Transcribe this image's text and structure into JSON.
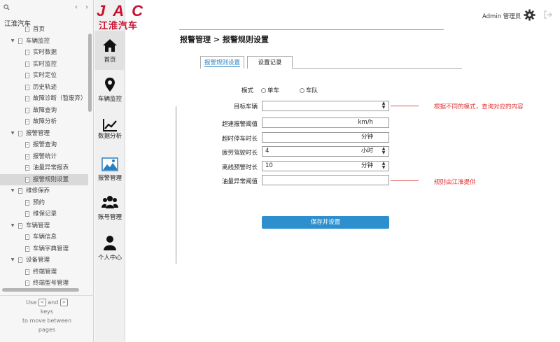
{
  "sidebar": {
    "doc_title": "江淮汽车",
    "prev": "‹",
    "next": "›",
    "tree": [
      {
        "label": "首页",
        "level": 1,
        "expand": ""
      },
      {
        "label": "车辆监控",
        "level": 0,
        "expand": "▼"
      },
      {
        "label": "实时数据",
        "level": 1,
        "expand": ""
      },
      {
        "label": "实时监控",
        "level": 1,
        "expand": ""
      },
      {
        "label": "实时定位",
        "level": 1,
        "expand": ""
      },
      {
        "label": "历史轨迹",
        "level": 1,
        "expand": ""
      },
      {
        "label": "故障诊断（暂废弃）",
        "level": 1,
        "expand": ""
      },
      {
        "label": "故障查询",
        "level": 1,
        "expand": ""
      },
      {
        "label": "故障分析",
        "level": 1,
        "expand": ""
      },
      {
        "label": "报警管理",
        "level": 0,
        "expand": "▼"
      },
      {
        "label": "报警查询",
        "level": 1,
        "expand": ""
      },
      {
        "label": "报警统计",
        "level": 1,
        "expand": ""
      },
      {
        "label": "油量异常报表",
        "level": 1,
        "expand": ""
      },
      {
        "label": "报警规则设置",
        "level": 1,
        "expand": "",
        "selected": true
      },
      {
        "label": "维修保养",
        "level": 0,
        "expand": "▼"
      },
      {
        "label": "预约",
        "level": 1,
        "expand": ""
      },
      {
        "label": "维保记录",
        "level": 1,
        "expand": ""
      },
      {
        "label": "车辆管理",
        "level": 0,
        "expand": "▼"
      },
      {
        "label": "车辆信息",
        "level": 1,
        "expand": ""
      },
      {
        "label": "车辆字典管理",
        "level": 1,
        "expand": ""
      },
      {
        "label": "设备管理",
        "level": 0,
        "expand": "▼"
      },
      {
        "label": "终端管理",
        "level": 1,
        "expand": ""
      },
      {
        "label": "终端型号管理",
        "level": 1,
        "expand": ""
      }
    ],
    "hint": {
      "use": "Use",
      "and": "and",
      "keys": "keys",
      "to_move": "to move between",
      "pages": "pages",
      "key_left": "<",
      "key_right": ">"
    }
  },
  "logo": {
    "brand": "JAC",
    "cn": "江淮汽车",
    "color": "#c8102e"
  },
  "nav": [
    {
      "label": "首页",
      "icon": "home-icon",
      "active": true
    },
    {
      "label": "车辆监控",
      "icon": "location-pin-icon",
      "active": false
    },
    {
      "label": "数据分析",
      "icon": "line-chart-icon",
      "active": false
    },
    {
      "label": "报警管理",
      "icon": "image-icon",
      "active": false
    },
    {
      "label": "账号管理",
      "icon": "users-icon",
      "active": false
    },
    {
      "label": "个人中心",
      "icon": "user-icon",
      "active": false
    }
  ],
  "header": {
    "user": "Admin 管理员"
  },
  "page": {
    "breadcrumb": "报警管理 > 报警规则设置",
    "tabs": [
      {
        "label": "报警规则设置",
        "active": true
      },
      {
        "label": "设置记录",
        "active": false
      }
    ]
  },
  "form": {
    "mode_label": "模式",
    "mode_options": [
      "单车",
      "车队"
    ],
    "target_label": "目标车辆",
    "target_value": "",
    "speed_label": "超速报警阈值",
    "speed_unit": "km/h",
    "speed_value": "",
    "stop_label": "超时停车时长",
    "stop_unit": "分钟",
    "stop_value": "",
    "fatigue_label": "疲劳驾驶时长",
    "fatigue_value": "4",
    "fatigue_unit": "小时",
    "offline_label": "离线预警时长",
    "offline_value": "10",
    "offline_unit": "分钟",
    "fuel_label": "油量异常阈值",
    "fuel_value": "",
    "save_label": "保存并设置"
  },
  "notes": {
    "target_note": "根据不同的模式，查询对应的内容",
    "fuel_note": "规则由江淮提供"
  },
  "colors": {
    "accent": "#2d8fce",
    "note": "#e03030",
    "brand": "#c8102e"
  }
}
